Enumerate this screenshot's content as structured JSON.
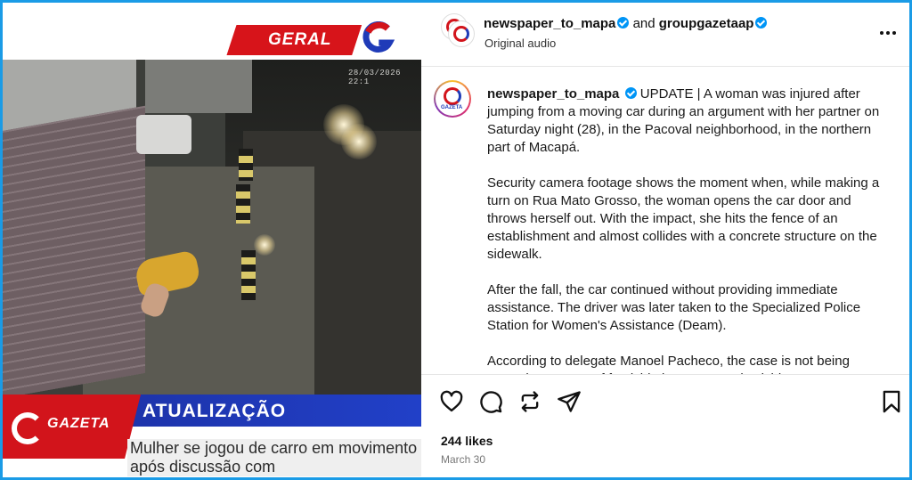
{
  "media": {
    "section_tag": "GERAL",
    "timestamp": "28/03/2026 22:1",
    "banner_title": "ATUALIZAÇÃO",
    "brand": "GAZETA",
    "headline": "Mulher se jogou de carro em movimento após discussão com"
  },
  "header": {
    "user1": "newspaper_to_mapa",
    "and_text": "and",
    "user2": "groupgazetaap",
    "audio": "Original audio",
    "more": "..."
  },
  "caption": {
    "user": "newspaper_to_mapa",
    "avatar_text": "GAZETA",
    "paragraphs": [
      "UPDATE | A woman was injured after jumping from a moving car during an argument with her partner on Saturday night (28), in the Pacoval neighborhood, in the northern part of Macapá.",
      "Security camera footage shows the moment when, while making a turn on Rua Mato Grosso, the woman opens the car door and throws herself out. With the impact, she hits the fence of an establishment and almost collides with a concrete structure on the sidewalk.",
      "After the fall, the car continued without providing immediate assistance. The driver was later taken to the Specialized Police Station for Women's Assistance (Deam).",
      "According to delegate Manoel Pacheco, the case is not being treated as a case of femicide but attempted suicide"
    ]
  },
  "actions": {
    "likes": "244 likes",
    "date": "March 30"
  },
  "colors": {
    "frame": "#1a9be6",
    "verified": "#0095f6",
    "brand_red": "#d2141b",
    "brand_blue": "#1f3bb8"
  }
}
